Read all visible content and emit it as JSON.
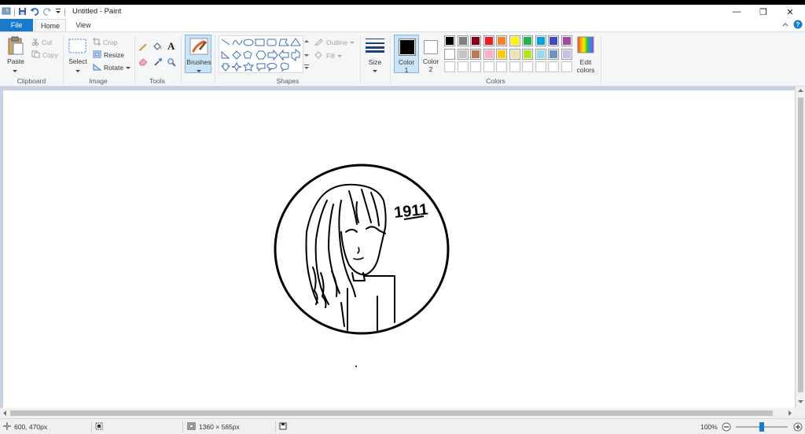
{
  "window": {
    "title": "Untitled - Paint",
    "controls": {
      "minimize": "—",
      "restore": "❐",
      "close": "✕"
    }
  },
  "tabs": {
    "file": "File",
    "home": "Home",
    "view": "View"
  },
  "clipboard": {
    "paste": "Paste",
    "cut": "Cut",
    "copy": "Copy",
    "group": "Clipboard"
  },
  "image": {
    "select": "Select",
    "crop": "Crop",
    "resize": "Resize",
    "rotate": "Rotate",
    "group": "Image"
  },
  "tools": {
    "group": "Tools",
    "text_glyph": "A"
  },
  "brushes": {
    "label": "Brushes"
  },
  "shapes": {
    "group": "Shapes",
    "outline": "Outline",
    "fill": "Fill"
  },
  "size": {
    "label": "Size"
  },
  "colors": {
    "color1_label": "Color",
    "color1_index": "1",
    "color2_label": "Color",
    "color2_index": "2",
    "edit_label": "Edit",
    "edit_label2": "colors",
    "group": "Colors",
    "color1_value": "#000000",
    "color2_value": "#ffffff",
    "palette_row1": [
      "#000000",
      "#7f7f7f",
      "#880015",
      "#ed1c24",
      "#ff7f27",
      "#fff200",
      "#22b14c",
      "#00a2e8",
      "#3f48cc",
      "#a349a4"
    ],
    "palette_row2": [
      "#ffffff",
      "#c3c3c3",
      "#b97a57",
      "#ffaec9",
      "#ffc90e",
      "#efe4b0",
      "#b5e61d",
      "#99d9ea",
      "#7092be",
      "#c8bfe7"
    ],
    "palette_row3": [
      "#ffffff",
      "#ffffff",
      "#ffffff",
      "#ffffff",
      "#ffffff",
      "#ffffff",
      "#ffffff",
      "#ffffff",
      "#ffffff",
      "#ffffff"
    ]
  },
  "drawing": {
    "year_text": "1911"
  },
  "status": {
    "cursor_position": "600, 470px",
    "image_size": "1360 × 565px",
    "zoom": "100%",
    "zoom_fraction": 0.5
  }
}
